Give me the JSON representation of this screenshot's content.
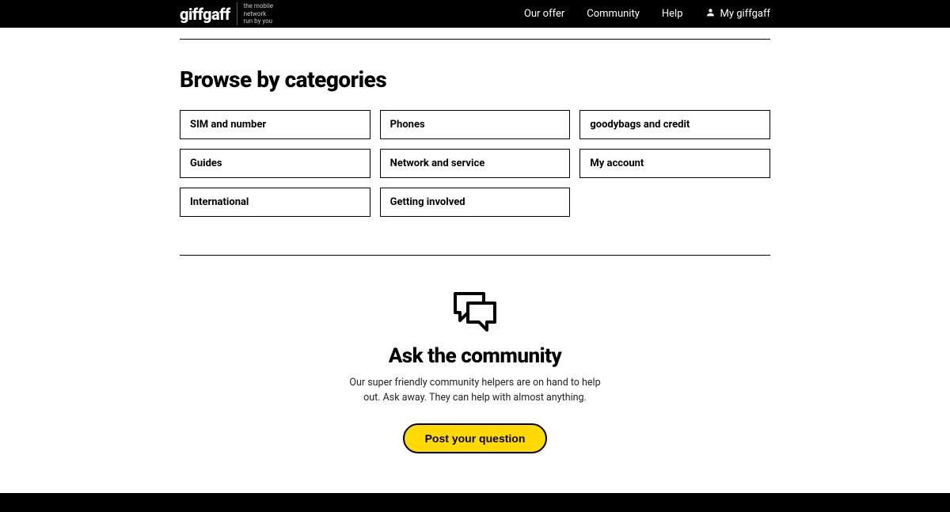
{
  "header": {
    "logo": "giffgaff",
    "tagline_line1": "the mobile",
    "tagline_line2": "network",
    "tagline_line3": "run by you",
    "nav": {
      "offer": "Our offer",
      "community": "Community",
      "help": "Help",
      "account": "My giffgaff"
    }
  },
  "categories": {
    "title": "Browse by categories",
    "items": [
      "SIM and number",
      "Phones",
      "goodybags and credit",
      "Guides",
      "Network and service",
      "My account",
      "International",
      "Getting involved"
    ]
  },
  "community": {
    "title": "Ask the community",
    "description": "Our super friendly community helpers are on hand to help out. Ask away. They can help with almost anything.",
    "button": "Post your question"
  }
}
